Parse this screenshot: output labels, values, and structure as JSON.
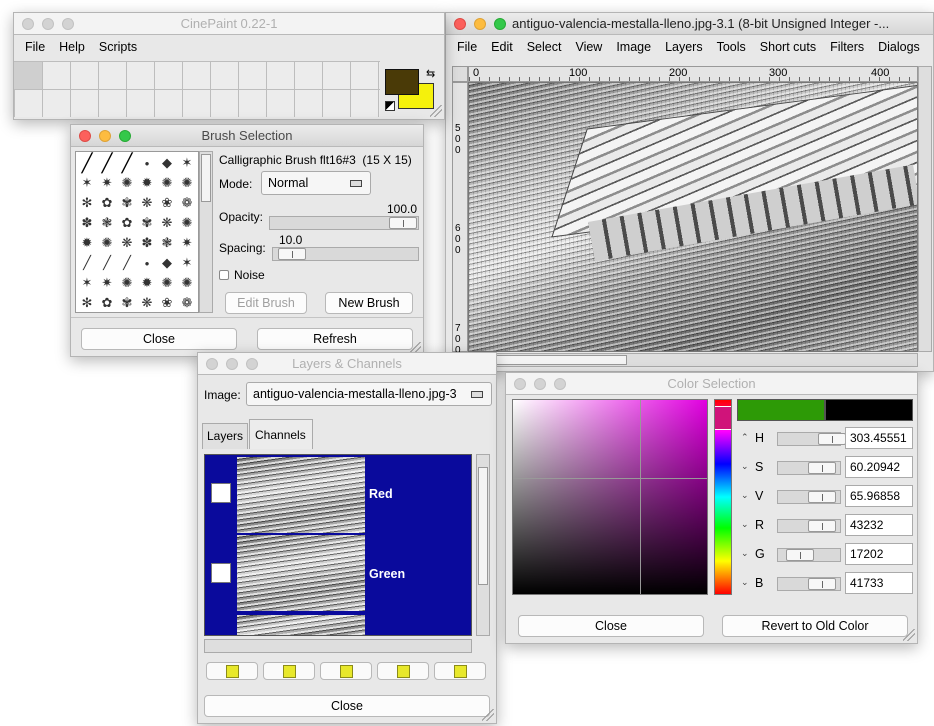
{
  "main_window": {
    "title": "CinePaint 0.22-1",
    "menu": [
      "File",
      "Help",
      "Scripts"
    ]
  },
  "image_window": {
    "title": "antiguo-valencia-mestalla-lleno.jpg-3.1 (8-bit Unsigned Integer -...",
    "menu": [
      "File",
      "Edit",
      "Select",
      "View",
      "Image",
      "Layers",
      "Tools",
      "Short cuts",
      "Filters",
      "Dialogs"
    ],
    "ruler_h": [
      "0",
      "100",
      "200",
      "300",
      "400"
    ],
    "ruler_v": [
      "5\n0\n0",
      "6\n0\n0",
      "7\n0\n0"
    ]
  },
  "brush_window": {
    "title": "Brush Selection",
    "brush_name": "Calligraphic Brush flt16#3",
    "brush_size": "(15 X 15)",
    "mode_label": "Mode:",
    "mode_value": "Normal",
    "opacity_label": "Opacity:",
    "opacity_value": "100.0",
    "opacity_level": 1.0,
    "spacing_label": "Spacing:",
    "spacing_value": "10.0",
    "spacing_level": 0.1,
    "noise_label": "Noise",
    "edit_brush": "Edit Brush",
    "new_brush": "New Brush",
    "close": "Close",
    "refresh": "Refresh"
  },
  "layers_window": {
    "title": "Layers & Channels",
    "image_label": "Image:",
    "image_value": "antiguo-valencia-mestalla-lleno.jpg-3",
    "tabs": [
      "Layers",
      "Channels"
    ],
    "channels": [
      "Red",
      "Green"
    ],
    "close": "Close"
  },
  "color_window": {
    "title": "Color Selection",
    "rows": [
      {
        "label": "H",
        "value": "303.45551"
      },
      {
        "label": "S",
        "value": "60.20942"
      },
      {
        "label": "V",
        "value": "65.96858"
      },
      {
        "label": "R",
        "value": "43232"
      },
      {
        "label": "G",
        "value": "17202"
      },
      {
        "label": "B",
        "value": "41733"
      }
    ],
    "close": "Close",
    "revert": "Revert to Old Color",
    "new_color": "#2d9a06",
    "old_color": "#000000"
  },
  "colors": {
    "fg": "#4a3a07",
    "bg": "#f5f10c",
    "channel_bg": "#0a0a9c",
    "selection": "#b02f9c"
  }
}
